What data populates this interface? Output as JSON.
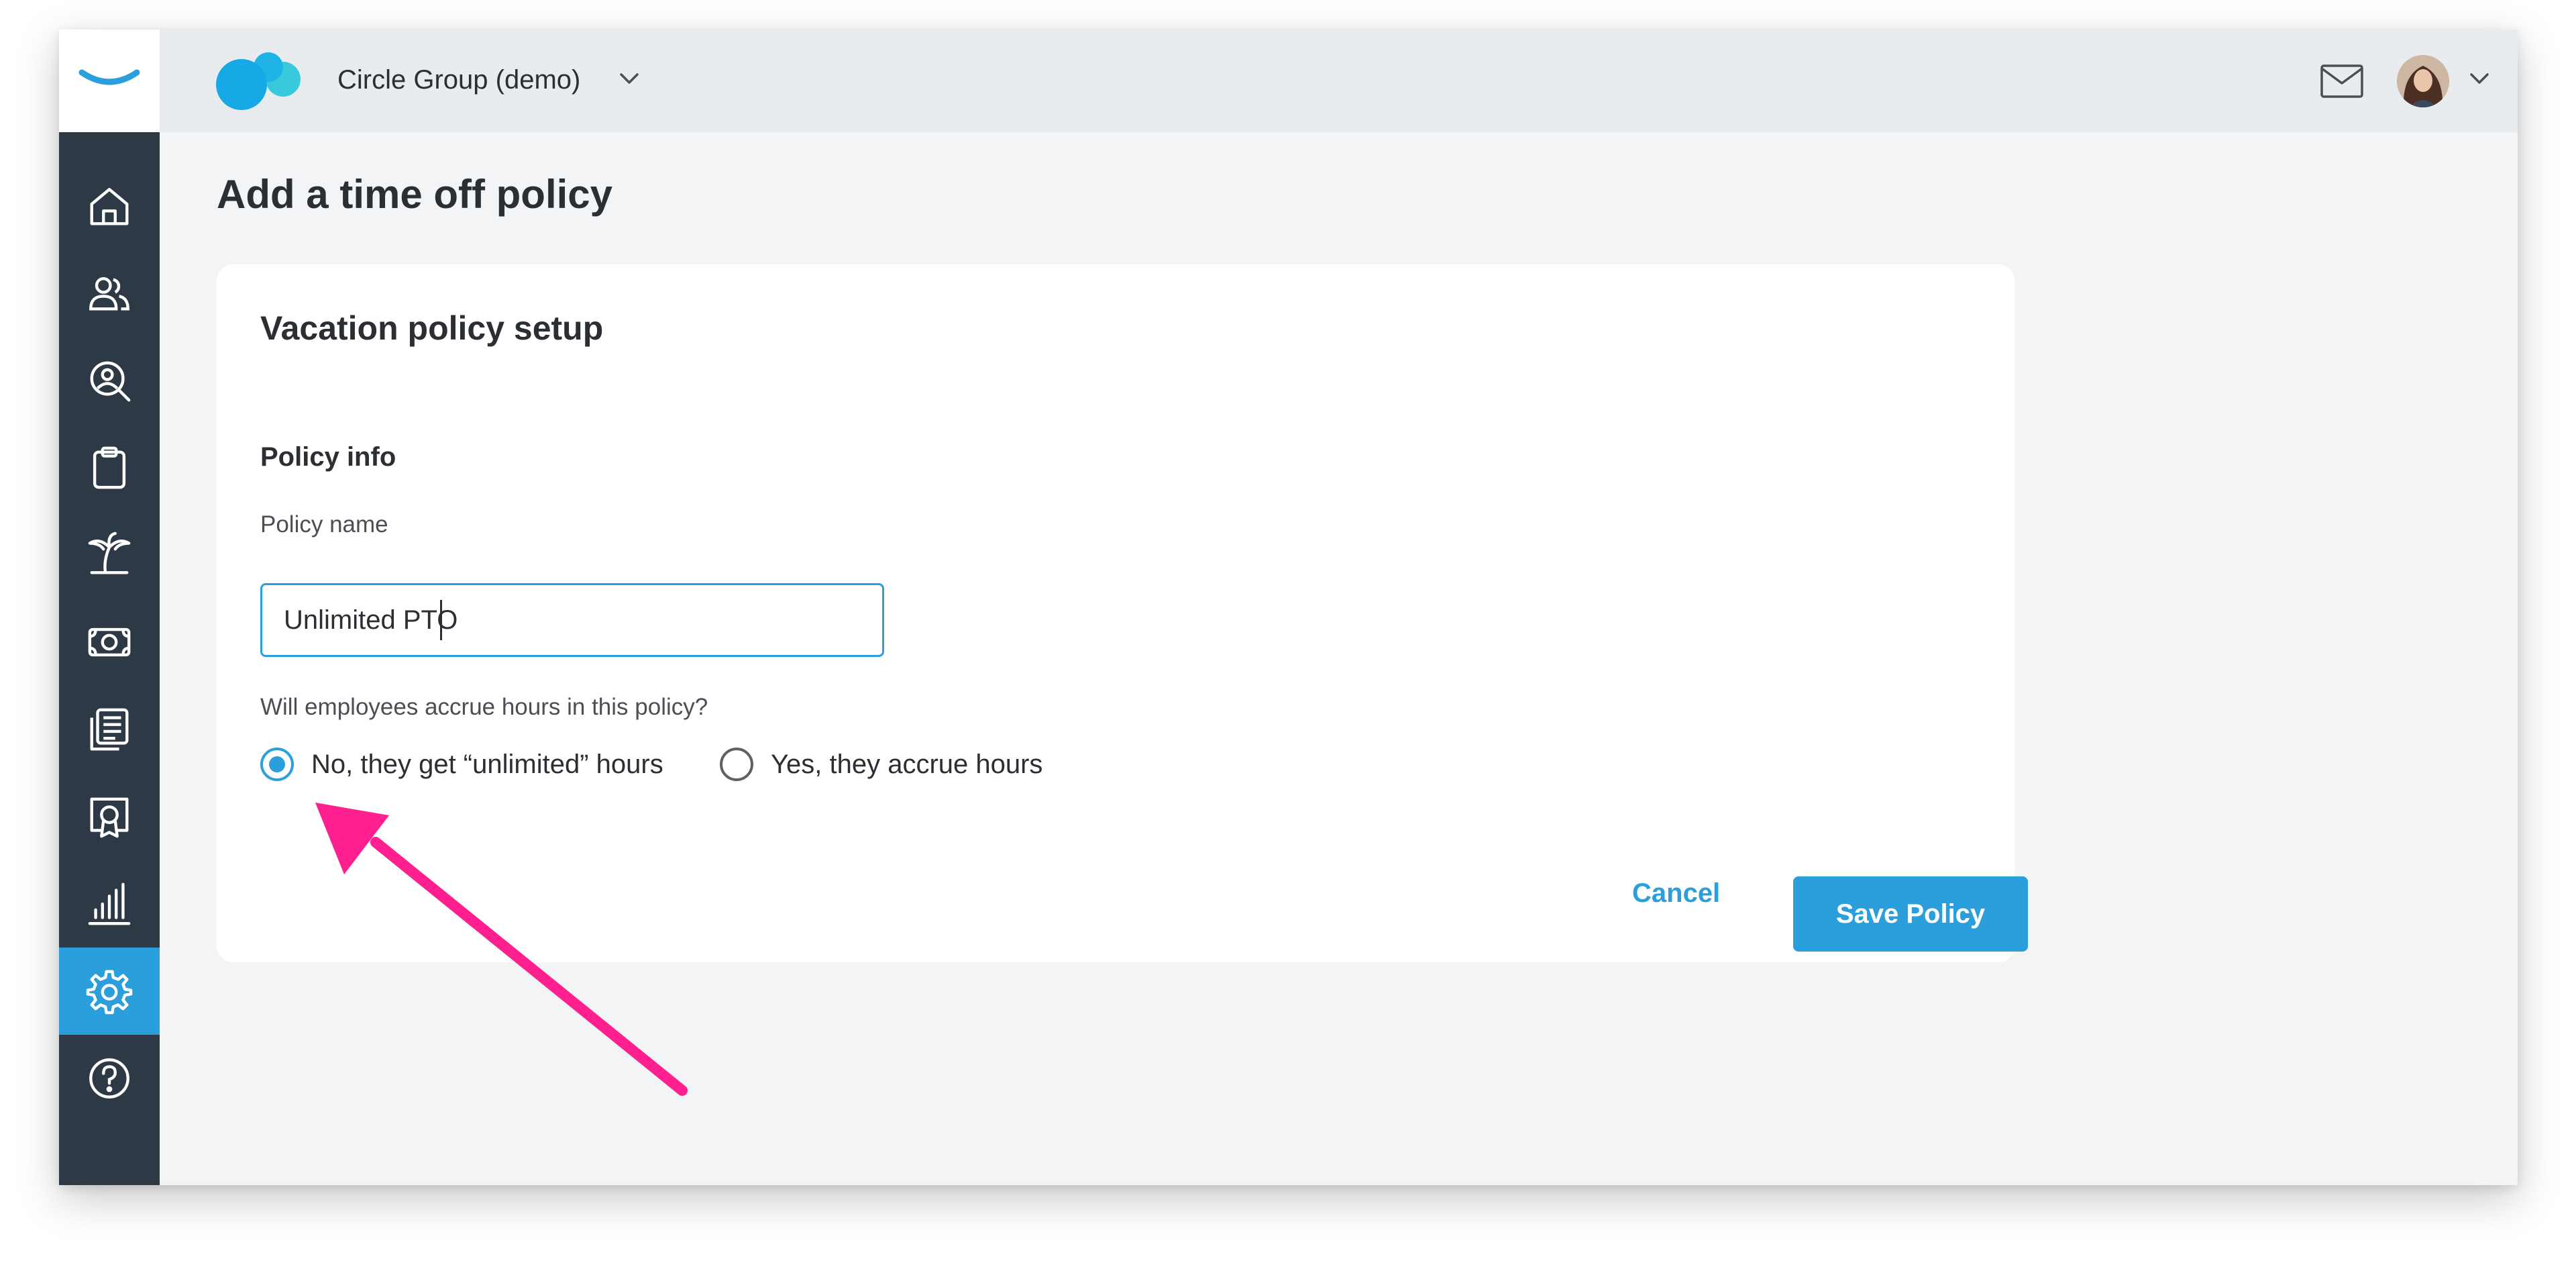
{
  "header": {
    "org_name": "Circle Group (demo)",
    "icons": {
      "org_dropdown": "chevron-down-icon",
      "mail": "mail-icon",
      "avatar": "avatar",
      "profile_dropdown": "chevron-down-icon"
    }
  },
  "sidebar": {
    "items": [
      {
        "icon": "home-icon",
        "active": false
      },
      {
        "icon": "people-icon",
        "active": false
      },
      {
        "icon": "person-search-icon",
        "active": false
      },
      {
        "icon": "clipboard-icon",
        "active": false
      },
      {
        "icon": "palm-tree-icon",
        "active": false
      },
      {
        "icon": "money-icon",
        "active": false
      },
      {
        "icon": "documents-icon",
        "active": false
      },
      {
        "icon": "certificate-icon",
        "active": false
      },
      {
        "icon": "bar-chart-icon",
        "active": false
      },
      {
        "icon": "gear-icon",
        "active": true
      },
      {
        "icon": "help-icon",
        "active": false
      }
    ]
  },
  "page": {
    "title": "Add a time off policy"
  },
  "form": {
    "card_title": "Vacation policy setup",
    "section_title": "Policy info",
    "policy_name_label": "Policy name",
    "policy_name_value": "Unlimited PTO",
    "question": "Will employees accrue hours in this policy?",
    "options": [
      {
        "label": "No, they get “unlimited” hours",
        "selected": true
      },
      {
        "label": "Yes, they accrue hours",
        "selected": false
      }
    ],
    "cancel_label": "Cancel",
    "save_label": "Save Policy"
  },
  "colors": {
    "accent": "#2a9fdc",
    "sidebar": "#2d3a45",
    "annotation_arrow": "#ff1f8e"
  }
}
